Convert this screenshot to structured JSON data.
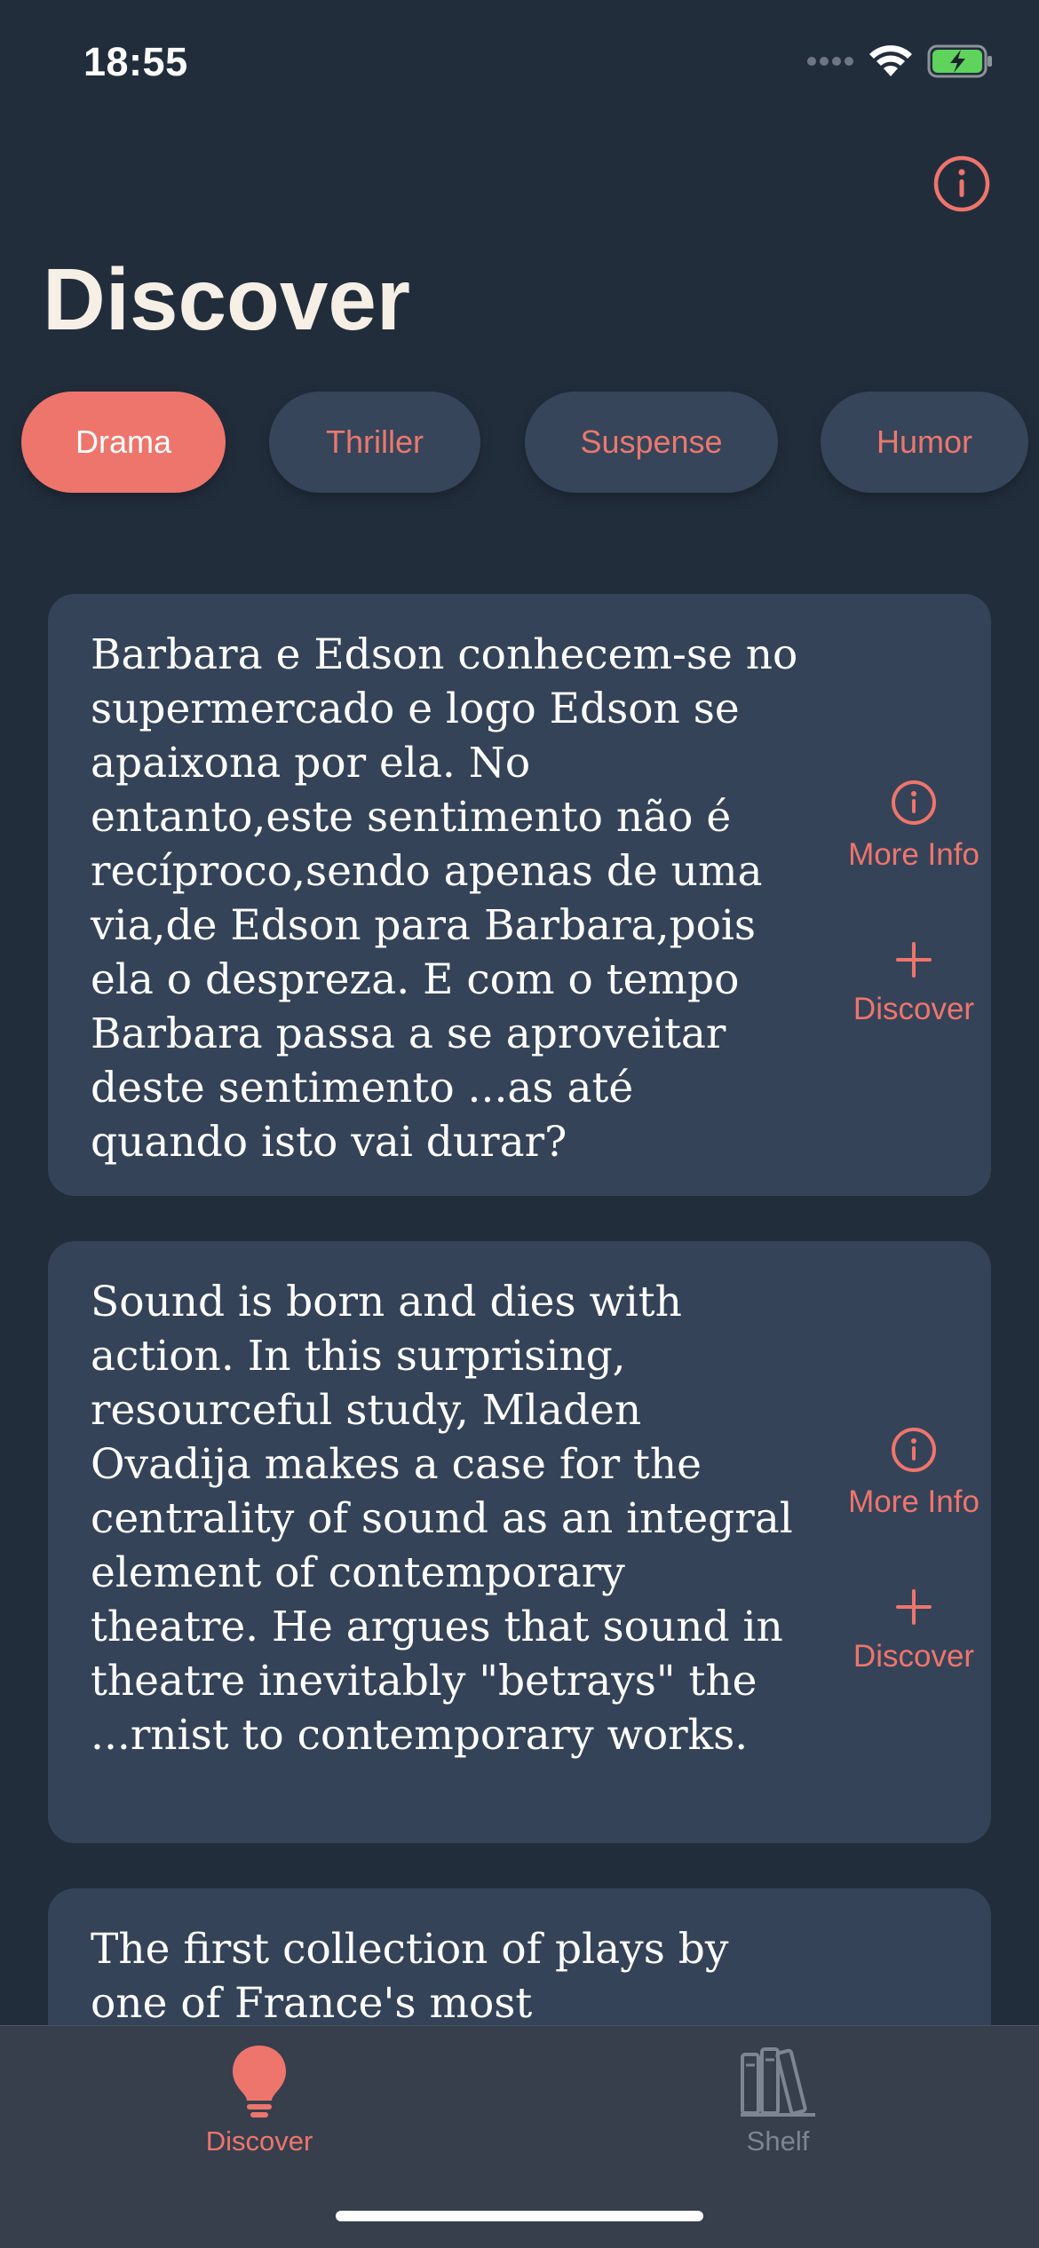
{
  "status_bar": {
    "time": "18:55",
    "icons": [
      "cellular-dots-icon",
      "wifi-icon",
      "battery-charging-icon"
    ]
  },
  "header": {
    "title": "Discover",
    "info_icon": "info-circle-icon"
  },
  "genres": [
    {
      "label": "Drama",
      "active": true
    },
    {
      "label": "Thriller",
      "active": false
    },
    {
      "label": "Suspense",
      "active": false
    },
    {
      "label": "Humor",
      "active": false
    }
  ],
  "cards": [
    {
      "description": "Barbara e Edson conhecem-se no supermercado e logo Edson se apaixona por ela. No entanto,este sentimento não é recíproco,sendo apenas de uma via,de Edson para Barbara,pois ela o despreza. E com o tempo Barbara passa a se aproveitar deste sentimento ...as até quando isto vai durar?",
      "more_info_label": "More Info",
      "discover_label": "Discover"
    },
    {
      "description": "Sound is born and dies with action. In this surprising, resourceful study, Mladen Ovadija makes a case for the centrality of sound as an integral element of contemporary theatre. He argues that sound in theatre inevitably \"betrays\" the ...rnist to contemporary works.",
      "more_info_label": "More Info",
      "discover_label": "Discover"
    },
    {
      "description": "The first collection of plays by one of France's most"
    }
  ],
  "tab_bar": {
    "tabs": [
      {
        "label": "Discover",
        "icon": "lightbulb-icon",
        "active": true
      },
      {
        "label": "Shelf",
        "icon": "books-icon",
        "active": false
      }
    ]
  },
  "colors": {
    "background": "#222d3c",
    "card": "#354359",
    "accent": "#ee756c",
    "chip": "#364559",
    "tab_bar": "#373f4d",
    "inactive": "#7d8591"
  }
}
